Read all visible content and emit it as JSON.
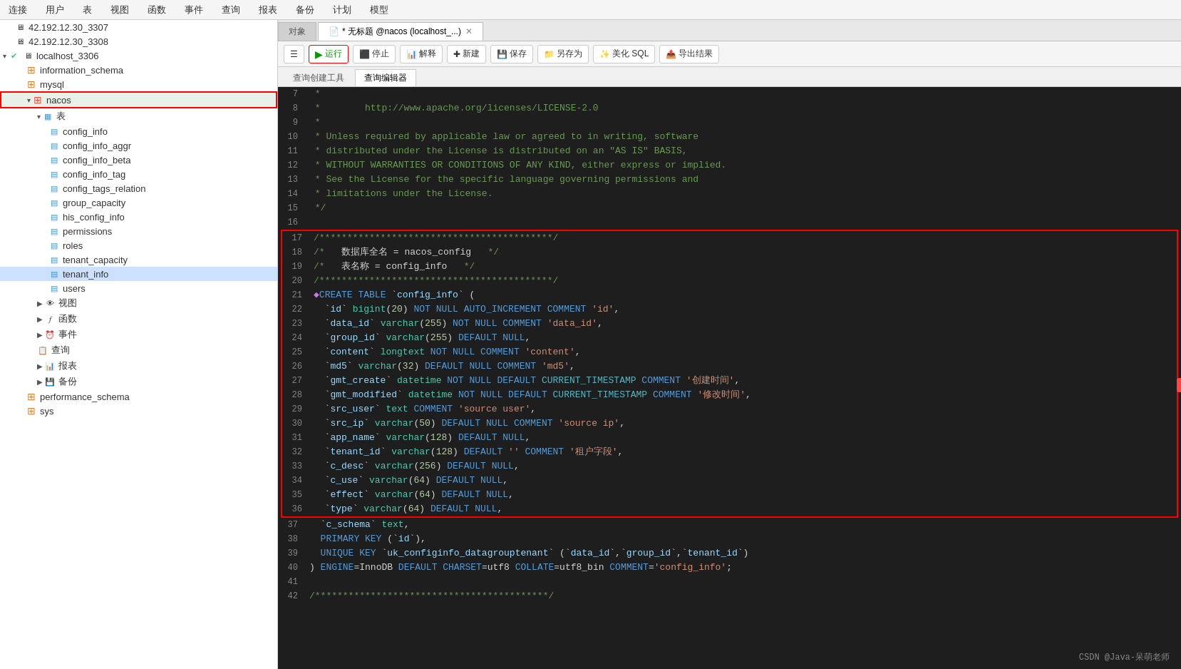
{
  "menu": {
    "items": [
      "连接",
      "用户",
      "表",
      "视图",
      "函数",
      "事件",
      "查询",
      "报表",
      "备份",
      "计划",
      "模型"
    ]
  },
  "sidebar": {
    "servers": [
      {
        "id": "server1",
        "label": "42.192.12.30_3307",
        "type": "server"
      },
      {
        "id": "server2",
        "label": "42.192.12.30_3308",
        "type": "server"
      },
      {
        "id": "localhost",
        "label": "localhost_3306",
        "type": "server",
        "expanded": true
      }
    ],
    "databases": [
      {
        "id": "information_schema",
        "label": "information_schema",
        "type": "db"
      },
      {
        "id": "mysql",
        "label": "mysql",
        "type": "db"
      },
      {
        "id": "nacos",
        "label": "nacos",
        "type": "db",
        "selected": true,
        "expanded": true
      },
      {
        "id": "performance_schema",
        "label": "performance_schema",
        "type": "db"
      },
      {
        "id": "sys",
        "label": "sys",
        "type": "db"
      }
    ],
    "tables": [
      "config_info",
      "config_info_aggr",
      "config_info_beta",
      "config_info_tag",
      "config_tags_relation",
      "group_capacity",
      "his_config_info",
      "permissions",
      "roles",
      "tenant_capacity",
      "tenant_info",
      "users"
    ],
    "folders": [
      "视图",
      "函数",
      "事件",
      "查询",
      "报表",
      "备份"
    ]
  },
  "tabs": {
    "main": [
      {
        "label": "对象",
        "active": false
      },
      {
        "label": "* 无标题 @nacos (localhost_...)",
        "active": true
      }
    ],
    "sub": [
      {
        "label": "查询创建工具",
        "active": false
      },
      {
        "label": "查询编辑器",
        "active": true
      }
    ]
  },
  "toolbar": {
    "run": "运行",
    "stop": "停止",
    "explain": "解释",
    "new": "新建",
    "save": "保存",
    "save_as": "另存为",
    "beautify": "美化 SQL",
    "export": "导出结果"
  },
  "code": {
    "lines": [
      {
        "num": 7,
        "content": " *",
        "highlight": false
      },
      {
        "num": 8,
        "content": " *        http://www.apache.org/licenses/LICENSE-2.0",
        "highlight": false
      },
      {
        "num": 9,
        "content": " *",
        "highlight": false
      },
      {
        "num": 10,
        "content": " * Unless required by applicable law or agreed to in writing, software",
        "highlight": false
      },
      {
        "num": 11,
        "content": " * distributed under the License is distributed on an \"AS IS\" BASIS,",
        "highlight": false
      },
      {
        "num": 12,
        "content": " * WITHOUT WARRANTIES OR CONDITIONS OF ANY KIND, either express or implied.",
        "highlight": false
      },
      {
        "num": 13,
        "content": " * See the License for the specific language governing permissions and",
        "highlight": false
      },
      {
        "num": 14,
        "content": " * limitations under the License.",
        "highlight": false
      },
      {
        "num": 15,
        "content": " */",
        "highlight": false
      },
      {
        "num": 16,
        "content": "",
        "highlight": false
      },
      {
        "num": 17,
        "content": "/******************************************/",
        "highlight": true
      },
      {
        "num": 18,
        "content": "/*   数据库全名 = nacos_config   */",
        "highlight": true
      },
      {
        "num": 19,
        "content": "/*   表名称 = config_info   */",
        "highlight": true
      },
      {
        "num": 20,
        "content": "/******************************************/",
        "highlight": true
      },
      {
        "num": 21,
        "content": "CREATE TABLE `config_info` (",
        "highlight": true
      },
      {
        "num": 22,
        "content": "  `id` bigint(20) NOT NULL AUTO_INCREMENT COMMENT 'id',",
        "highlight": true
      },
      {
        "num": 23,
        "content": "  `data_id` varchar(255) NOT NULL COMMENT 'data_id',",
        "highlight": true
      },
      {
        "num": 24,
        "content": "  `group_id` varchar(255) DEFAULT NULL,",
        "highlight": true
      },
      {
        "num": 25,
        "content": "  `content` longtext NOT NULL COMMENT 'content',",
        "highlight": true
      },
      {
        "num": 26,
        "content": "  `md5` varchar(32) DEFAULT NULL COMMENT 'md5',",
        "highlight": true
      },
      {
        "num": 27,
        "content": "  `gmt_create` datetime NOT NULL DEFAULT CURRENT_TIMESTAMP COMMENT '创建时间',",
        "highlight": true
      },
      {
        "num": 28,
        "content": "  `gmt_modified` datetime NOT NULL DEFAULT CURRENT_TIMESTAMP COMMENT '修改时间',",
        "highlight": true
      },
      {
        "num": 29,
        "content": "  `src_user` text COMMENT 'source user',",
        "highlight": true
      },
      {
        "num": 30,
        "content": "  `src_ip` varchar(50) DEFAULT NULL COMMENT 'source ip',",
        "highlight": true
      },
      {
        "num": 31,
        "content": "  `app_name` varchar(128) DEFAULT NULL,",
        "highlight": true
      },
      {
        "num": 32,
        "content": "  `tenant_id` varchar(128) DEFAULT '' COMMENT '租户字段',",
        "highlight": true
      },
      {
        "num": 33,
        "content": "  `c_desc` varchar(256) DEFAULT NULL,",
        "highlight": true
      },
      {
        "num": 34,
        "content": "  `c_use` varchar(64) DEFAULT NULL,",
        "highlight": true
      },
      {
        "num": 35,
        "content": "  `effect` varchar(64) DEFAULT NULL,",
        "highlight": true
      },
      {
        "num": 36,
        "content": "  `type` varchar(64) DEFAULT NULL,",
        "highlight": true
      },
      {
        "num": 37,
        "content": "  `c_schema` text,",
        "highlight": false
      },
      {
        "num": 38,
        "content": "  PRIMARY KEY (`id`),",
        "highlight": false
      },
      {
        "num": 39,
        "content": "  UNIQUE KEY `uk_configinfo_datagrouptenant` (`data_id`,`group_id`,`tenant_id`)",
        "highlight": false
      },
      {
        "num": 40,
        "content": ") ENGINE=InnoDB DEFAULT CHARSET=utf8 COLLATE=utf8_bin COMMENT='config_info';",
        "highlight": false
      },
      {
        "num": 41,
        "content": "",
        "highlight": false
      },
      {
        "num": 42,
        "content": "/******************************************/",
        "highlight": false
      }
    ]
  },
  "watermark": "CSDN @Java-呆萌老师"
}
